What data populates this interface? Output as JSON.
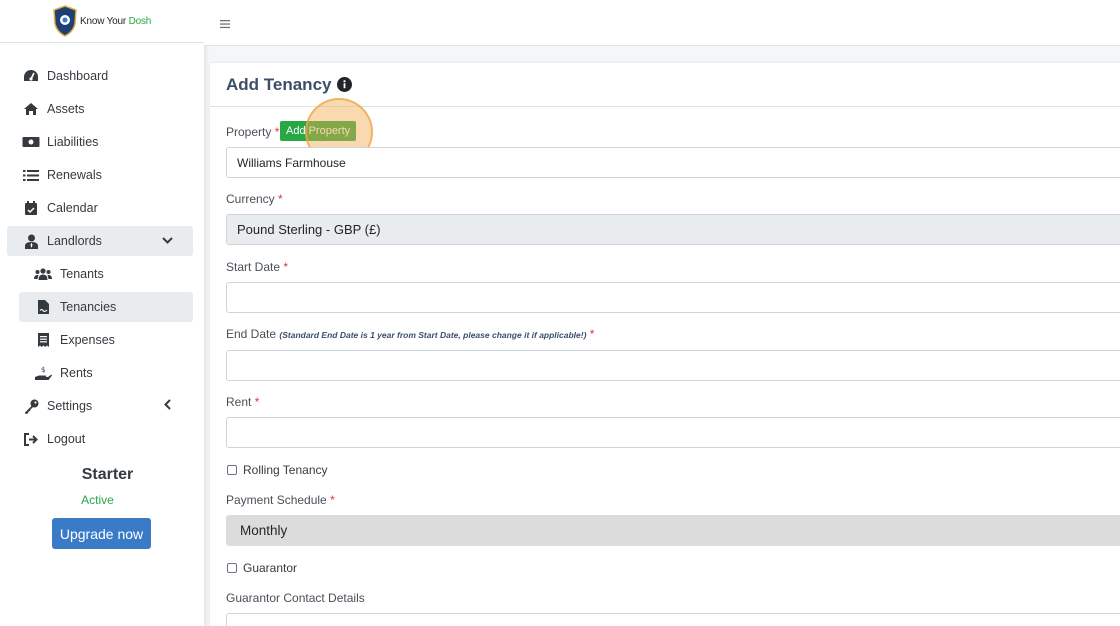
{
  "brand": {
    "name_part1": "Know Your ",
    "name_part2": "Dosh"
  },
  "sidebar": {
    "items": [
      {
        "label": "Dashboard",
        "icon": "tachometer-icon"
      },
      {
        "label": "Assets",
        "icon": "home-icon"
      },
      {
        "label": "Liabilities",
        "icon": "money-bill-icon"
      },
      {
        "label": "Renewals",
        "icon": "list-icon"
      },
      {
        "label": "Calendar",
        "icon": "calendar-check-icon"
      },
      {
        "label": "Landlords",
        "icon": "user-tie-icon"
      },
      {
        "label": "Tenants",
        "icon": "users-icon"
      },
      {
        "label": "Tenancies",
        "icon": "file-contract-icon"
      },
      {
        "label": "Expenses",
        "icon": "receipt-icon"
      },
      {
        "label": "Rents",
        "icon": "hand-holding-dollar-icon"
      },
      {
        "label": "Settings",
        "icon": "key-icon"
      },
      {
        "label": "Logout",
        "icon": "sign-out-icon"
      }
    ],
    "active_item": "Tenancies"
  },
  "plan": {
    "name": "Starter",
    "status": "Active",
    "upgrade_label": "Upgrade now"
  },
  "page": {
    "title": "Add Tenancy"
  },
  "form": {
    "property_label": "Property",
    "add_property_label_1": "Add",
    "add_property_label_2": "Property",
    "property_value": "Williams Farmhouse",
    "currency_label": "Currency",
    "currency_value": "Pound Sterling - GBP (£)",
    "start_date_label": "Start Date",
    "start_date_value": "",
    "end_date_label": "End Date",
    "end_date_hint": "(Standard End Date is 1 year from Start Date, please change it if applicable!)",
    "end_date_value": "",
    "rent_label": "Rent",
    "rent_value": "",
    "rolling_label": "Rolling Tenancy",
    "payment_schedule_label": "Payment Schedule",
    "payment_schedule_value": "Monthly",
    "guarantor_label": "Guarantor",
    "guarantor_contact_label": "Guarantor Contact Details",
    "required_mark": "*"
  },
  "colors": {
    "accent_green": "#28a745",
    "primary_blue": "#3a7bc8",
    "required_red": "#dc3545",
    "highlight_orange": "#f0aa50"
  }
}
